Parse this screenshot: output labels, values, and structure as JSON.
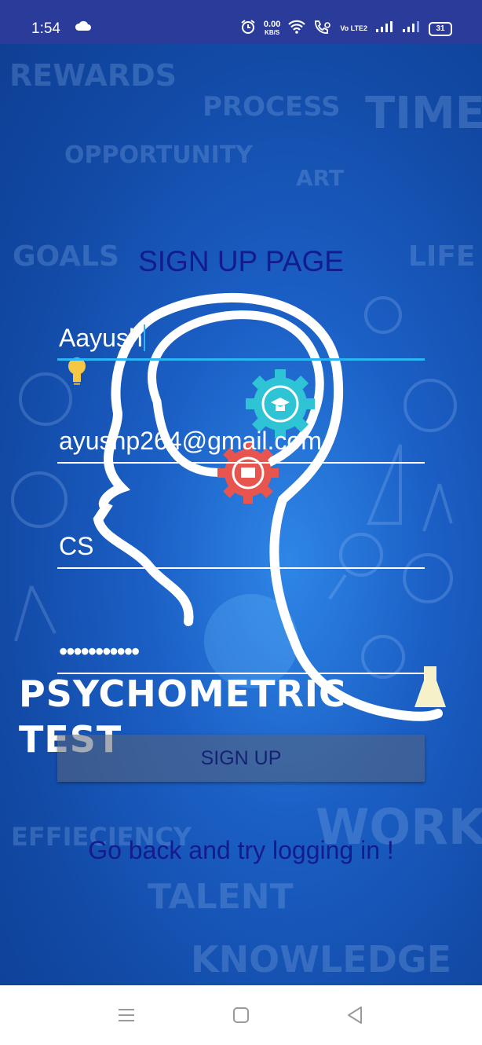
{
  "status_bar": {
    "time": "1:54",
    "net_speed_value": "0.00",
    "net_speed_unit": "KB/S",
    "volte": "Vo LTE2",
    "battery": "31"
  },
  "background_words": [
    "REWARDS",
    "PROCESS",
    "TIME",
    "OPPORTUNITY",
    "ART",
    "GOALS",
    "LIFE",
    "EFFIECIENCY",
    "WORK",
    "TALENT",
    "KNOWLEDGE"
  ],
  "logo": {
    "line1": "PSYCHOMETRIC",
    "line2": "TEST"
  },
  "form": {
    "title": "SIGN UP PAGE",
    "name_value": "Aayush",
    "email_value": "ayushp264@gmail.com",
    "department_value": "CS",
    "password_value": "•••••••••••",
    "signup_label": "SIGN UP",
    "login_link": "Go back and try logging in !"
  },
  "colors": {
    "status_bar": "#2a3b9a",
    "background": "#1b5fc5",
    "title_text": "#141b8c",
    "focus_line": "#29b6f6",
    "gear_teal": "#2ec4d6",
    "gear_red": "#e8554e"
  },
  "icons": [
    "cloud-icon",
    "alarm-icon",
    "wifi-icon",
    "call-icon",
    "signal-icon",
    "battery-icon",
    "bulb-icon",
    "gear-icon",
    "flask-icon",
    "menu-icon",
    "home-icon",
    "back-icon"
  ]
}
